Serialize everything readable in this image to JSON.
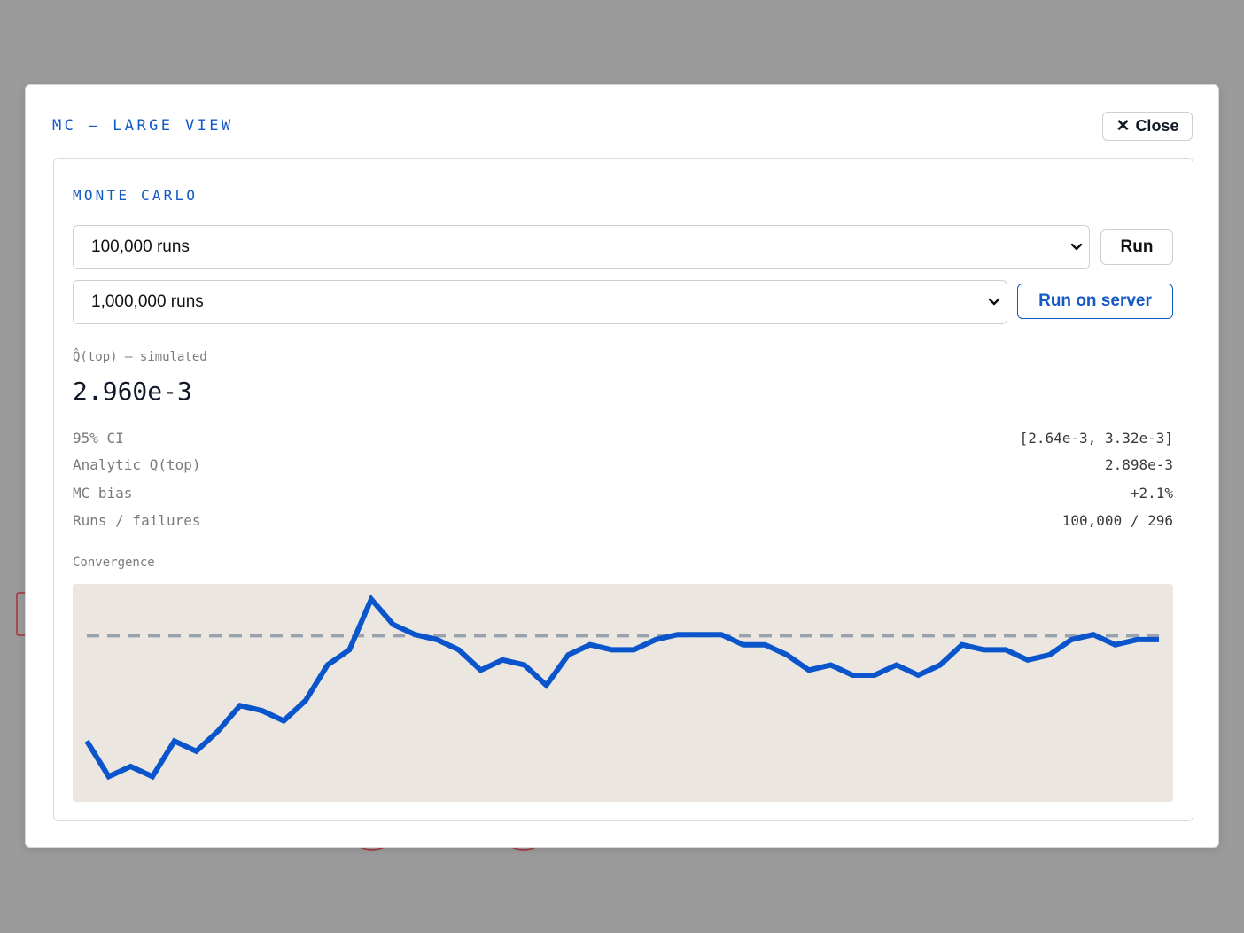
{
  "modal": {
    "title": "MC — LARGE VIEW",
    "close_label": "Close"
  },
  "panel": {
    "title": "MONTE CARLO",
    "run_select_value": "100,000 runs",
    "run_label": "Run",
    "server_select_value": "1,000,000 runs",
    "server_label": "Run on server"
  },
  "estimate": {
    "label": "Q̂(top) — simulated",
    "value": "2.960e-3"
  },
  "stats": [
    {
      "label": "95% CI",
      "value": "[2.64e-3, 3.32e-3]"
    },
    {
      "label": "Analytic Q(top)",
      "value": "2.898e-3"
    },
    {
      "label": "MC bias",
      "value": "+2.1%"
    },
    {
      "label": "Runs / failures",
      "value": "100,000 / 296"
    }
  ],
  "convergence_label": "Convergence",
  "colors": {
    "accent": "#1359c4",
    "line": "#0b55cc",
    "reference": "#9aa3ad",
    "chart_bg": "#ebe7e0",
    "backdrop": "#9b9b9b"
  },
  "icons": {
    "close": "close-icon",
    "select": "chevron-down-icon"
  },
  "chart_data": {
    "type": "line",
    "reference_line": 2.898,
    "series": [
      {
        "values": [
          2.69,
          2.62,
          2.64,
          2.62,
          2.69,
          2.67,
          2.71,
          2.76,
          2.75,
          2.73,
          2.77,
          2.84,
          2.87,
          2.97,
          2.92,
          2.9,
          2.89,
          2.87,
          2.83,
          2.85,
          2.84,
          2.8,
          2.86,
          2.88,
          2.87,
          2.87,
          2.89,
          2.9,
          2.9,
          2.9,
          2.88,
          2.88,
          2.86,
          2.83,
          2.84,
          2.82,
          2.82,
          2.84,
          2.82,
          2.84,
          2.88,
          2.87,
          2.87,
          2.85,
          2.86,
          2.89,
          2.9,
          2.88,
          2.89,
          2.89
        ]
      }
    ],
    "ylim": [
      2.57,
      3.0
    ],
    "grid": false,
    "legend": "none"
  }
}
